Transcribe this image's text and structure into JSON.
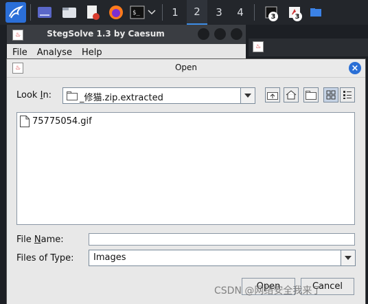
{
  "taskbar": {
    "workspaces": [
      "1",
      "2",
      "3",
      "4"
    ],
    "active_workspace": "2",
    "terminal_badge": "3",
    "stegsolve_badge": "3"
  },
  "back_window": {
    "title": "StegSolve 1.3 by Caesum",
    "menu": [
      "File",
      "Analyse",
      "Help"
    ]
  },
  "dialog": {
    "title": "Open",
    "look_in_label_pre": "Look ",
    "look_in_label_key": "I",
    "look_in_label_post": "n:",
    "look_in_value": "_修猫.zip.extracted",
    "files": [
      "75775054.gif"
    ],
    "file_name_label_pre": "File ",
    "file_name_label_key": "N",
    "file_name_label_post": "ame:",
    "file_name_value": "",
    "files_of_type_label": "Files of Type:",
    "files_of_type_value": "Images",
    "open_label": "Open",
    "cancel_label": "Cancel"
  },
  "watermark": "CSDN @网络安全我来了",
  "colors": {
    "taskbar": "#23262b",
    "accent": "#2a6fd6",
    "dialog_bg": "#e8e8e8"
  }
}
